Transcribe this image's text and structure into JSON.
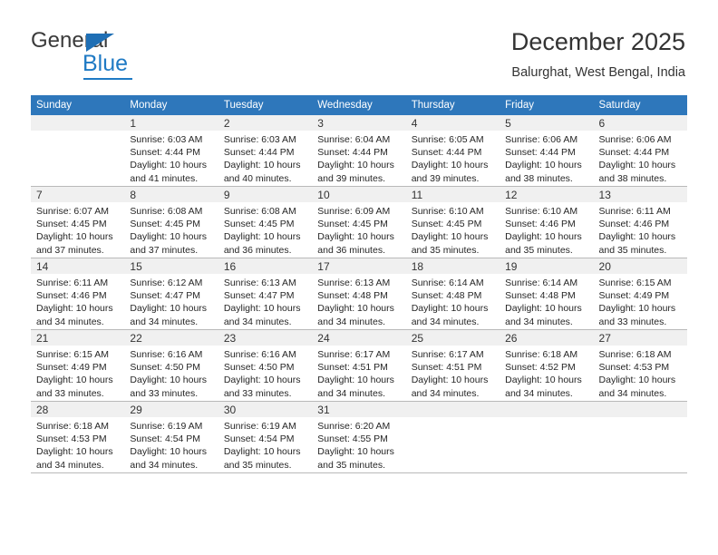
{
  "brand": {
    "name_part1": "General",
    "name_part2": "Blue",
    "logo_icon": "triangle-flag-icon",
    "accent_color": "#1f7ac4"
  },
  "header": {
    "title": "December 2025",
    "subtitle": "Balurghat, West Bengal, India",
    "header_bg_color": "#2e77bb"
  },
  "calendar": {
    "weekdays": [
      "Sunday",
      "Monday",
      "Tuesday",
      "Wednesday",
      "Thursday",
      "Friday",
      "Saturday"
    ],
    "weeks": [
      [
        {
          "day": "",
          "lines": []
        },
        {
          "day": "1",
          "lines": [
            "Sunrise: 6:03 AM",
            "Sunset: 4:44 PM",
            "Daylight: 10 hours",
            "and 41 minutes."
          ]
        },
        {
          "day": "2",
          "lines": [
            "Sunrise: 6:03 AM",
            "Sunset: 4:44 PM",
            "Daylight: 10 hours",
            "and 40 minutes."
          ]
        },
        {
          "day": "3",
          "lines": [
            "Sunrise: 6:04 AM",
            "Sunset: 4:44 PM",
            "Daylight: 10 hours",
            "and 39 minutes."
          ]
        },
        {
          "day": "4",
          "lines": [
            "Sunrise: 6:05 AM",
            "Sunset: 4:44 PM",
            "Daylight: 10 hours",
            "and 39 minutes."
          ]
        },
        {
          "day": "5",
          "lines": [
            "Sunrise: 6:06 AM",
            "Sunset: 4:44 PM",
            "Daylight: 10 hours",
            "and 38 minutes."
          ]
        },
        {
          "day": "6",
          "lines": [
            "Sunrise: 6:06 AM",
            "Sunset: 4:44 PM",
            "Daylight: 10 hours",
            "and 38 minutes."
          ]
        }
      ],
      [
        {
          "day": "7",
          "lines": [
            "Sunrise: 6:07 AM",
            "Sunset: 4:45 PM",
            "Daylight: 10 hours",
            "and 37 minutes."
          ]
        },
        {
          "day": "8",
          "lines": [
            "Sunrise: 6:08 AM",
            "Sunset: 4:45 PM",
            "Daylight: 10 hours",
            "and 37 minutes."
          ]
        },
        {
          "day": "9",
          "lines": [
            "Sunrise: 6:08 AM",
            "Sunset: 4:45 PM",
            "Daylight: 10 hours",
            "and 36 minutes."
          ]
        },
        {
          "day": "10",
          "lines": [
            "Sunrise: 6:09 AM",
            "Sunset: 4:45 PM",
            "Daylight: 10 hours",
            "and 36 minutes."
          ]
        },
        {
          "day": "11",
          "lines": [
            "Sunrise: 6:10 AM",
            "Sunset: 4:45 PM",
            "Daylight: 10 hours",
            "and 35 minutes."
          ]
        },
        {
          "day": "12",
          "lines": [
            "Sunrise: 6:10 AM",
            "Sunset: 4:46 PM",
            "Daylight: 10 hours",
            "and 35 minutes."
          ]
        },
        {
          "day": "13",
          "lines": [
            "Sunrise: 6:11 AM",
            "Sunset: 4:46 PM",
            "Daylight: 10 hours",
            "and 35 minutes."
          ]
        }
      ],
      [
        {
          "day": "14",
          "lines": [
            "Sunrise: 6:11 AM",
            "Sunset: 4:46 PM",
            "Daylight: 10 hours",
            "and 34 minutes."
          ]
        },
        {
          "day": "15",
          "lines": [
            "Sunrise: 6:12 AM",
            "Sunset: 4:47 PM",
            "Daylight: 10 hours",
            "and 34 minutes."
          ]
        },
        {
          "day": "16",
          "lines": [
            "Sunrise: 6:13 AM",
            "Sunset: 4:47 PM",
            "Daylight: 10 hours",
            "and 34 minutes."
          ]
        },
        {
          "day": "17",
          "lines": [
            "Sunrise: 6:13 AM",
            "Sunset: 4:48 PM",
            "Daylight: 10 hours",
            "and 34 minutes."
          ]
        },
        {
          "day": "18",
          "lines": [
            "Sunrise: 6:14 AM",
            "Sunset: 4:48 PM",
            "Daylight: 10 hours",
            "and 34 minutes."
          ]
        },
        {
          "day": "19",
          "lines": [
            "Sunrise: 6:14 AM",
            "Sunset: 4:48 PM",
            "Daylight: 10 hours",
            "and 34 minutes."
          ]
        },
        {
          "day": "20",
          "lines": [
            "Sunrise: 6:15 AM",
            "Sunset: 4:49 PM",
            "Daylight: 10 hours",
            "and 33 minutes."
          ]
        }
      ],
      [
        {
          "day": "21",
          "lines": [
            "Sunrise: 6:15 AM",
            "Sunset: 4:49 PM",
            "Daylight: 10 hours",
            "and 33 minutes."
          ]
        },
        {
          "day": "22",
          "lines": [
            "Sunrise: 6:16 AM",
            "Sunset: 4:50 PM",
            "Daylight: 10 hours",
            "and 33 minutes."
          ]
        },
        {
          "day": "23",
          "lines": [
            "Sunrise: 6:16 AM",
            "Sunset: 4:50 PM",
            "Daylight: 10 hours",
            "and 33 minutes."
          ]
        },
        {
          "day": "24",
          "lines": [
            "Sunrise: 6:17 AM",
            "Sunset: 4:51 PM",
            "Daylight: 10 hours",
            "and 34 minutes."
          ]
        },
        {
          "day": "25",
          "lines": [
            "Sunrise: 6:17 AM",
            "Sunset: 4:51 PM",
            "Daylight: 10 hours",
            "and 34 minutes."
          ]
        },
        {
          "day": "26",
          "lines": [
            "Sunrise: 6:18 AM",
            "Sunset: 4:52 PM",
            "Daylight: 10 hours",
            "and 34 minutes."
          ]
        },
        {
          "day": "27",
          "lines": [
            "Sunrise: 6:18 AM",
            "Sunset: 4:53 PM",
            "Daylight: 10 hours",
            "and 34 minutes."
          ]
        }
      ],
      [
        {
          "day": "28",
          "lines": [
            "Sunrise: 6:18 AM",
            "Sunset: 4:53 PM",
            "Daylight: 10 hours",
            "and 34 minutes."
          ]
        },
        {
          "day": "29",
          "lines": [
            "Sunrise: 6:19 AM",
            "Sunset: 4:54 PM",
            "Daylight: 10 hours",
            "and 34 minutes."
          ]
        },
        {
          "day": "30",
          "lines": [
            "Sunrise: 6:19 AM",
            "Sunset: 4:54 PM",
            "Daylight: 10 hours",
            "and 35 minutes."
          ]
        },
        {
          "day": "31",
          "lines": [
            "Sunrise: 6:20 AM",
            "Sunset: 4:55 PM",
            "Daylight: 10 hours",
            "and 35 minutes."
          ]
        },
        {
          "day": "",
          "lines": []
        },
        {
          "day": "",
          "lines": []
        },
        {
          "day": "",
          "lines": []
        }
      ]
    ]
  }
}
